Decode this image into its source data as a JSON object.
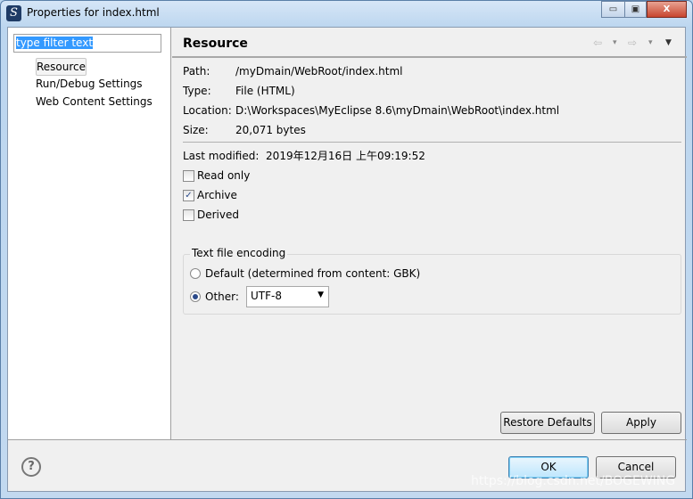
{
  "window": {
    "title": "Properties for index.html",
    "minimize": "▭",
    "maximize": "▣",
    "close": "X"
  },
  "sidebar": {
    "filter_text": "type filter text",
    "items": [
      {
        "label": "Resource",
        "selected": true
      },
      {
        "label": "Run/Debug Settings"
      },
      {
        "label": "Web Content Settings"
      }
    ]
  },
  "page": {
    "title": "Resource",
    "nav": {
      "back": "⇦",
      "forward": "⇨",
      "dropdown": "▾",
      "menu": "▼"
    }
  },
  "info": [
    {
      "key": "Path:",
      "value": "/myDmain/WebRoot/index.html"
    },
    {
      "key": "Type:",
      "value": "File  (HTML)"
    },
    {
      "key": "Location:",
      "value": "D:\\Workspaces\\MyEclipse 8.6\\myDmain\\WebRoot\\index.html"
    },
    {
      "key": "Size:",
      "value": "20,071  bytes"
    }
  ],
  "last_modified": {
    "label": "Last modified:",
    "value": "2019年12月16日 上午09:19:52"
  },
  "attributes": [
    {
      "label": "Read only",
      "checked": false
    },
    {
      "label": "Archive",
      "checked": true
    },
    {
      "label": "Derived",
      "checked": false
    }
  ],
  "encoding": {
    "group_label": "Text file encoding",
    "default_label": "Default (determined from content: GBK)",
    "other_label": "Other:",
    "selected": "other",
    "value": "UTF-8"
  },
  "buttons": {
    "restore": "Restore Defaults",
    "apply": "Apply",
    "ok": "OK",
    "cancel": "Cancel",
    "help": "?"
  },
  "watermark": "https://blog.csdn.net/BOGEWING"
}
